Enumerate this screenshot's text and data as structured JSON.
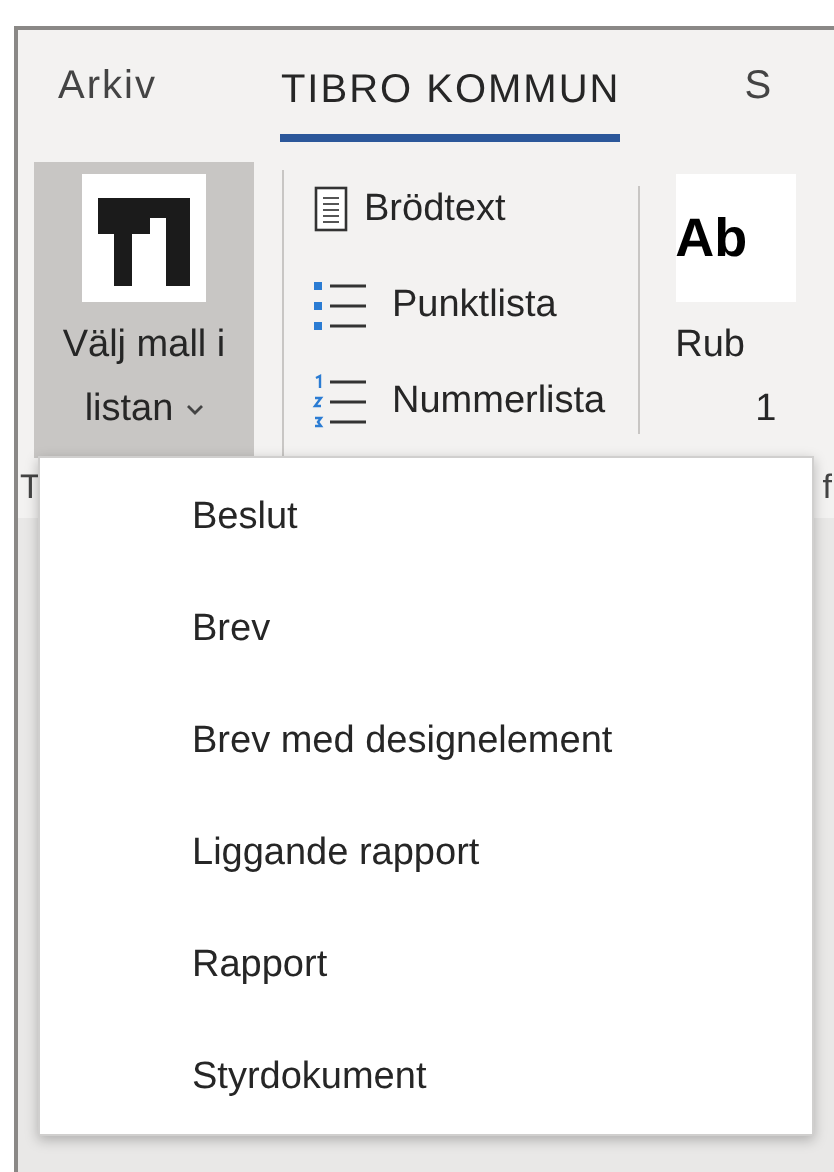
{
  "tabs": [
    {
      "label": "Arkiv",
      "selected": false
    },
    {
      "label": "TIBRO KOMMUN",
      "selected": true
    },
    {
      "label": "S",
      "selected": false
    }
  ],
  "ribbon": {
    "template_button": {
      "label_lines": [
        "Välj mall i",
        "listan"
      ],
      "expanded": true
    },
    "paragraph_styles": [
      {
        "kind": "text",
        "label": "Brödtext"
      },
      {
        "kind": "bullets",
        "label": "Punktlista"
      },
      {
        "kind": "numbers",
        "label": "Nummerlista"
      }
    ],
    "style_preview": {
      "sample": "Ab",
      "label_lines": [
        "Rub",
        "1"
      ]
    },
    "group_labels": [
      "T",
      "f"
    ]
  },
  "template_menu": {
    "items": [
      {
        "label": "Beslut"
      },
      {
        "label": "Brev"
      },
      {
        "label": "Brev med designelement"
      },
      {
        "label": "Liggande rapport"
      },
      {
        "label": "Rapport"
      },
      {
        "label": "Styrdokument"
      }
    ]
  }
}
